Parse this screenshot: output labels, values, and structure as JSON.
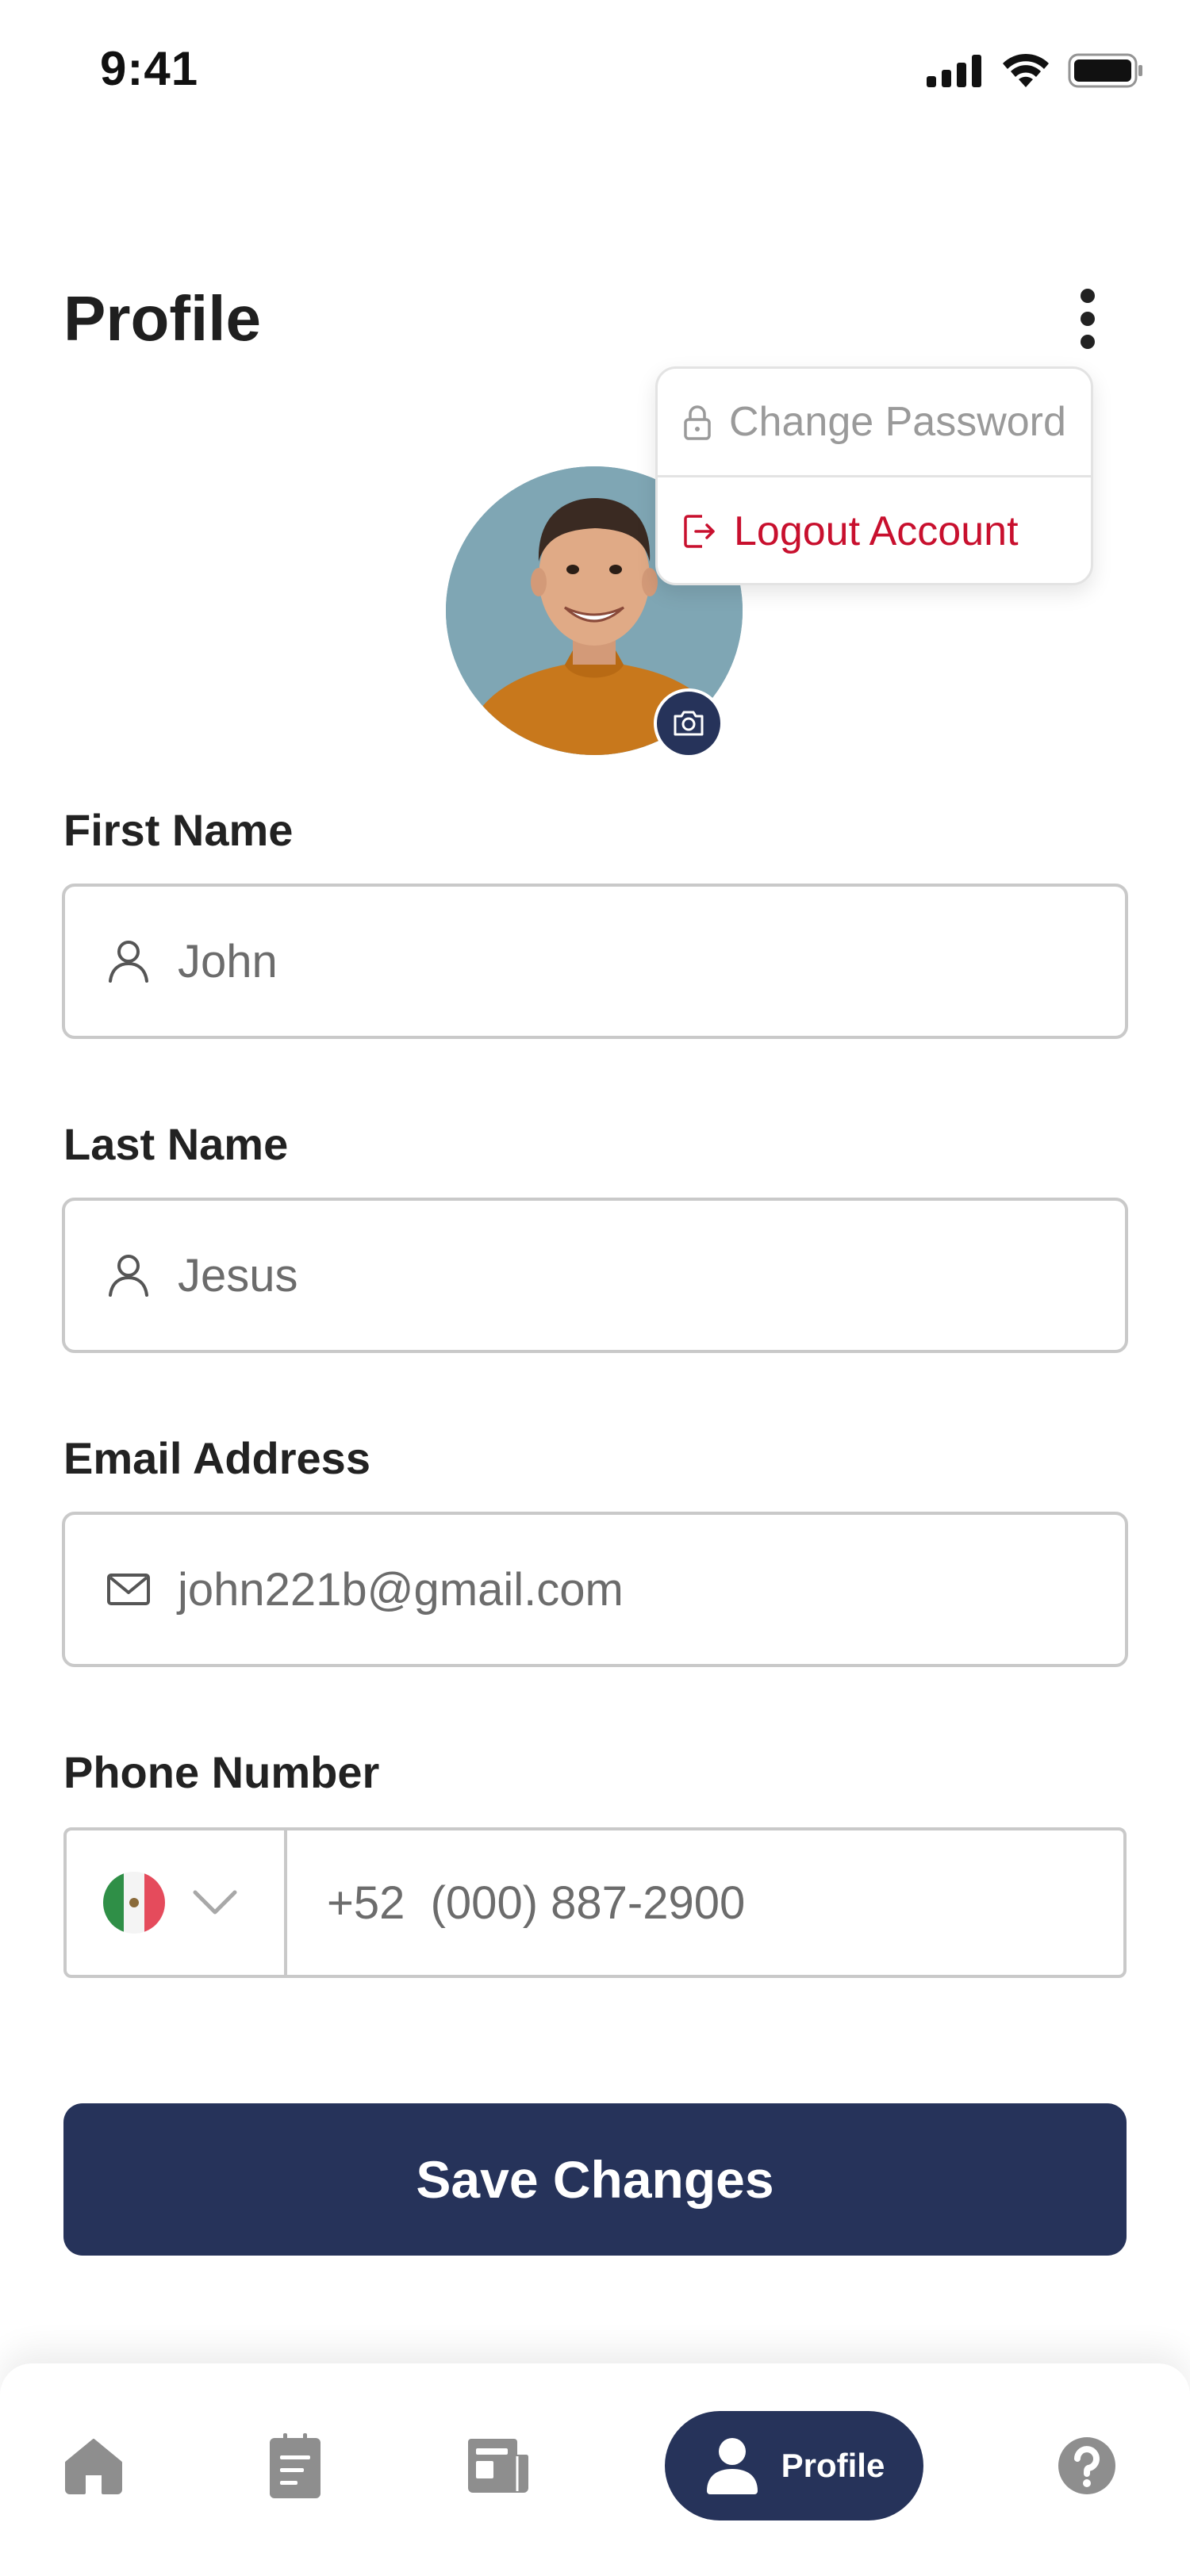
{
  "status_bar": {
    "time": "9:41"
  },
  "header": {
    "title": "Profile"
  },
  "menu": {
    "items": [
      {
        "label": "Change Password",
        "icon": "lock-icon",
        "color": "#9a9a9a"
      },
      {
        "label": "Logout Account",
        "icon": "logout-icon",
        "color": "#c8102e"
      }
    ]
  },
  "form": {
    "first_name": {
      "label": "First Name",
      "value": "John",
      "icon": "user-icon"
    },
    "last_name": {
      "label": "Last Name",
      "value": "Jesus",
      "icon": "user-icon"
    },
    "email": {
      "label": "Email Address",
      "value": "john221b@gmail.com",
      "icon": "mail-icon"
    },
    "phone": {
      "label": "Phone Number",
      "country_flag": "mexico-flag-icon",
      "value": "+52  (000) 887-2900"
    }
  },
  "save_button": {
    "label": "Save Changes"
  },
  "bottom_nav": {
    "items": [
      {
        "name": "home",
        "icon": "home-icon"
      },
      {
        "name": "clipboard",
        "icon": "clipboard-icon"
      },
      {
        "name": "news",
        "icon": "newspaper-icon"
      },
      {
        "name": "profile",
        "icon": "person-icon",
        "label": "Profile",
        "active": true
      },
      {
        "name": "help",
        "icon": "help-icon"
      }
    ]
  },
  "colors": {
    "primary": "#26335a",
    "danger": "#c8102e",
    "border": "#c9c9c9",
    "muted": "#9a9a9a"
  }
}
